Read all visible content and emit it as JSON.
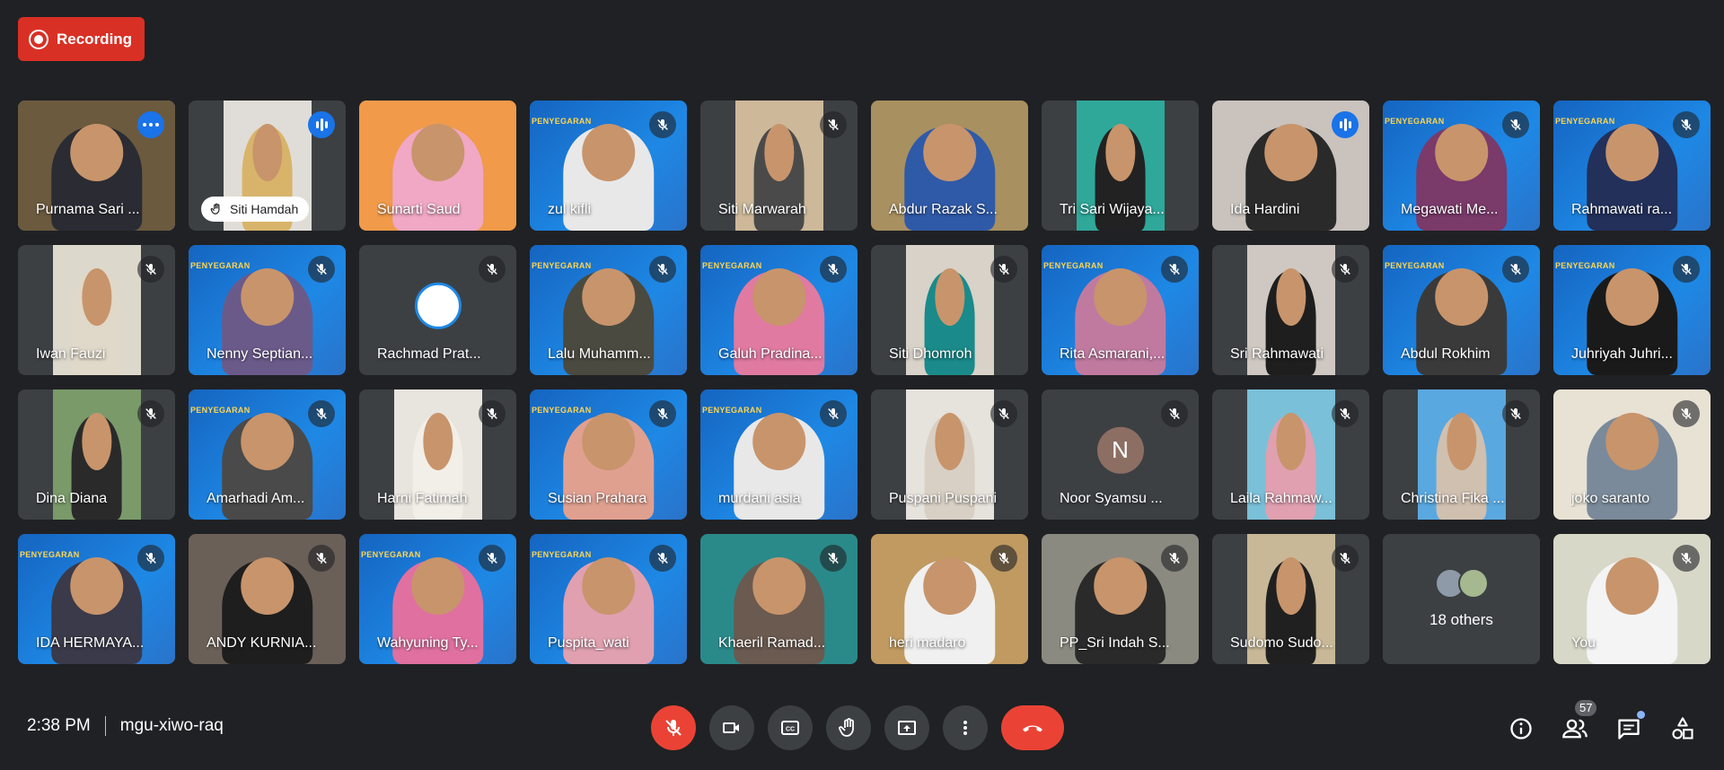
{
  "recording": {
    "label": "Recording"
  },
  "participants": [
    {
      "name": "Purnama Sari ...",
      "state": "more",
      "bg": "#6b5a3e",
      "shirt": "#2b2b33",
      "narrow": false,
      "active": true
    },
    {
      "name": "Siti Hamdah",
      "state": "speaking",
      "hand": true,
      "bg": "#e0ddd8",
      "shirt": "#d8b46a",
      "narrow": true
    },
    {
      "name": "Sunarti Saud",
      "state": "none",
      "bg": "#f09a4a",
      "shirt": "#f0a8c4",
      "narrow": false
    },
    {
      "name": "zul kifli",
      "state": "muted",
      "bg": "banner",
      "shirt": "#e8e8e8",
      "narrow": false
    },
    {
      "name": "Siti Marwarah",
      "state": "muted",
      "bg": "#cdb89a",
      "shirt": "#4a4a4a",
      "narrow": true
    },
    {
      "name": "Abdur Razak S...",
      "state": "none",
      "bg": "#a89060",
      "shirt": "#2f5aa8",
      "narrow": false
    },
    {
      "name": "Tri Sari Wijaya...",
      "state": "none",
      "bg": "#2fa89a",
      "shirt": "#222",
      "narrow": true
    },
    {
      "name": "Ida Hardini",
      "state": "speaking",
      "bg": "#c9c2bd",
      "shirt": "#2a2a2a",
      "narrow": false
    },
    {
      "name": "Megawati Me...",
      "state": "muted",
      "bg": "banner",
      "shirt": "#7a3a6a",
      "narrow": false
    },
    {
      "name": "Rahmawati ra...",
      "state": "muted",
      "bg": "banner",
      "shirt": "#22305a",
      "narrow": false
    },
    {
      "name": "Iwan Fauzi",
      "state": "muted",
      "bg": "#ddd8cc",
      "shirt": "#e0d8c8",
      "narrow": true
    },
    {
      "name": "Nenny Septian...",
      "state": "muted",
      "bg": "banner",
      "shirt": "#6a5a8a",
      "narrow": false
    },
    {
      "name": "Rachmad Prat...",
      "state": "muted",
      "avatar": "logo",
      "narrow": false
    },
    {
      "name": "Lalu Muhamm...",
      "state": "muted",
      "bg": "banner",
      "shirt": "#4a4a40",
      "narrow": false
    },
    {
      "name": "Galuh Pradina...",
      "state": "muted",
      "bg": "banner",
      "shirt": "#e07aa0",
      "narrow": false
    },
    {
      "name": "Siti Dhomroh",
      "state": "muted",
      "bg": "#d8d2c8",
      "shirt": "#1a8a8a",
      "narrow": true
    },
    {
      "name": "Rita Asmarani,...",
      "state": "muted",
      "bg": "banner",
      "shirt": "#c07aa0",
      "narrow": false
    },
    {
      "name": "Sri Rahmawati",
      "state": "muted",
      "bg": "#cfc8c2",
      "shirt": "#1e1e1e",
      "narrow": true
    },
    {
      "name": "Abdul Rokhim",
      "state": "muted",
      "bg": "banner",
      "shirt": "#3a3a3a",
      "narrow": false
    },
    {
      "name": "Juhriyah Juhri...",
      "state": "muted",
      "bg": "banner",
      "shirt": "#1a1a1a",
      "narrow": false
    },
    {
      "name": "Dina Diana",
      "state": "muted",
      "bg": "#7a9a6a",
      "shirt": "#2a2a2a",
      "narrow": true
    },
    {
      "name": "Amarhadi Am...",
      "state": "muted",
      "bg": "banner",
      "shirt": "#4a4a4a",
      "narrow": false
    },
    {
      "name": "Harni Fatimah",
      "state": "muted",
      "bg": "#e8e4de",
      "shirt": "#f2efe8",
      "narrow": true
    },
    {
      "name": "Susian Prahara",
      "state": "muted",
      "bg": "banner",
      "shirt": "#e0a090",
      "narrow": false
    },
    {
      "name": "murdani asia",
      "state": "muted",
      "bg": "banner",
      "shirt": "#e8e8e8",
      "narrow": false
    },
    {
      "name": "Puspani Puspani",
      "state": "muted",
      "bg": "#e6e2dc",
      "shirt": "#d8d0c4",
      "narrow": true
    },
    {
      "name": "Noor Syamsu ...",
      "state": "muted",
      "avatar": "letter",
      "letter": "N",
      "narrow": false
    },
    {
      "name": "Laila Rahmaw...",
      "state": "muted",
      "bg": "#7ac0d8",
      "shirt": "#e0a0b0",
      "narrow": true
    },
    {
      "name": "Christina Fika ...",
      "state": "muted",
      "bg": "#5aa8e0",
      "shirt": "#d0c0b0",
      "narrow": true
    },
    {
      "name": "joko saranto",
      "state": "muted",
      "bg": "#e8e2d4",
      "shirt": "#7a8a9a",
      "narrow": false
    },
    {
      "name": "IDA HERMAYA...",
      "state": "muted",
      "bg": "banner",
      "shirt": "#3a3a4a",
      "narrow": false
    },
    {
      "name": "ANDY KURNIA...",
      "state": "muted",
      "bg": "#6a6058",
      "shirt": "#1e1e1e",
      "narrow": false
    },
    {
      "name": "Wahyuning Ty...",
      "state": "muted",
      "bg": "banner",
      "shirt": "#e070a0",
      "narrow": false
    },
    {
      "name": "Puspita_wati",
      "state": "muted",
      "bg": "banner",
      "shirt": "#e0a0b0",
      "narrow": false
    },
    {
      "name": "Khaeril Ramad...",
      "state": "muted",
      "bg": "#2a8a8a",
      "shirt": "#6a5a50",
      "narrow": false
    },
    {
      "name": "heri madaro",
      "state": "muted",
      "bg": "#c09a60",
      "shirt": "#f0f0f0",
      "narrow": false
    },
    {
      "name": "PP_Sri Indah S...",
      "state": "muted",
      "bg": "#8a8a80",
      "shirt": "#2a2a2a",
      "narrow": false
    },
    {
      "name": "Sudomo Sudo...",
      "state": "muted",
      "bg": "#c8b898",
      "shirt": "#202020",
      "narrow": true
    },
    {
      "name": "18 others",
      "state": "others",
      "narrow": false
    },
    {
      "name": "You",
      "state": "muted",
      "bg": "#d8d8c8",
      "shirt": "#f4f4f4",
      "narrow": false,
      "you": true
    }
  ],
  "footer": {
    "time": "2:38 PM",
    "meeting_code": "mgu-xiwo-raq",
    "participant_count": "57"
  },
  "controls": [
    {
      "name": "mic-off-button",
      "icon": "mic-off-icon"
    },
    {
      "name": "camera-button",
      "icon": "camera-icon"
    },
    {
      "name": "captions-button",
      "icon": "cc-icon"
    },
    {
      "name": "raise-hand-button",
      "icon": "hand-icon"
    },
    {
      "name": "present-button",
      "icon": "present-icon"
    },
    {
      "name": "more-options-button",
      "icon": "more-vert-icon"
    },
    {
      "name": "leave-call-button",
      "icon": "end-call-icon"
    }
  ],
  "colors": {
    "background": "#202124",
    "tile": "#3c4043",
    "danger": "#ea4335",
    "speaking": "#1a73e8",
    "active_outline": "#8ab4f8"
  }
}
